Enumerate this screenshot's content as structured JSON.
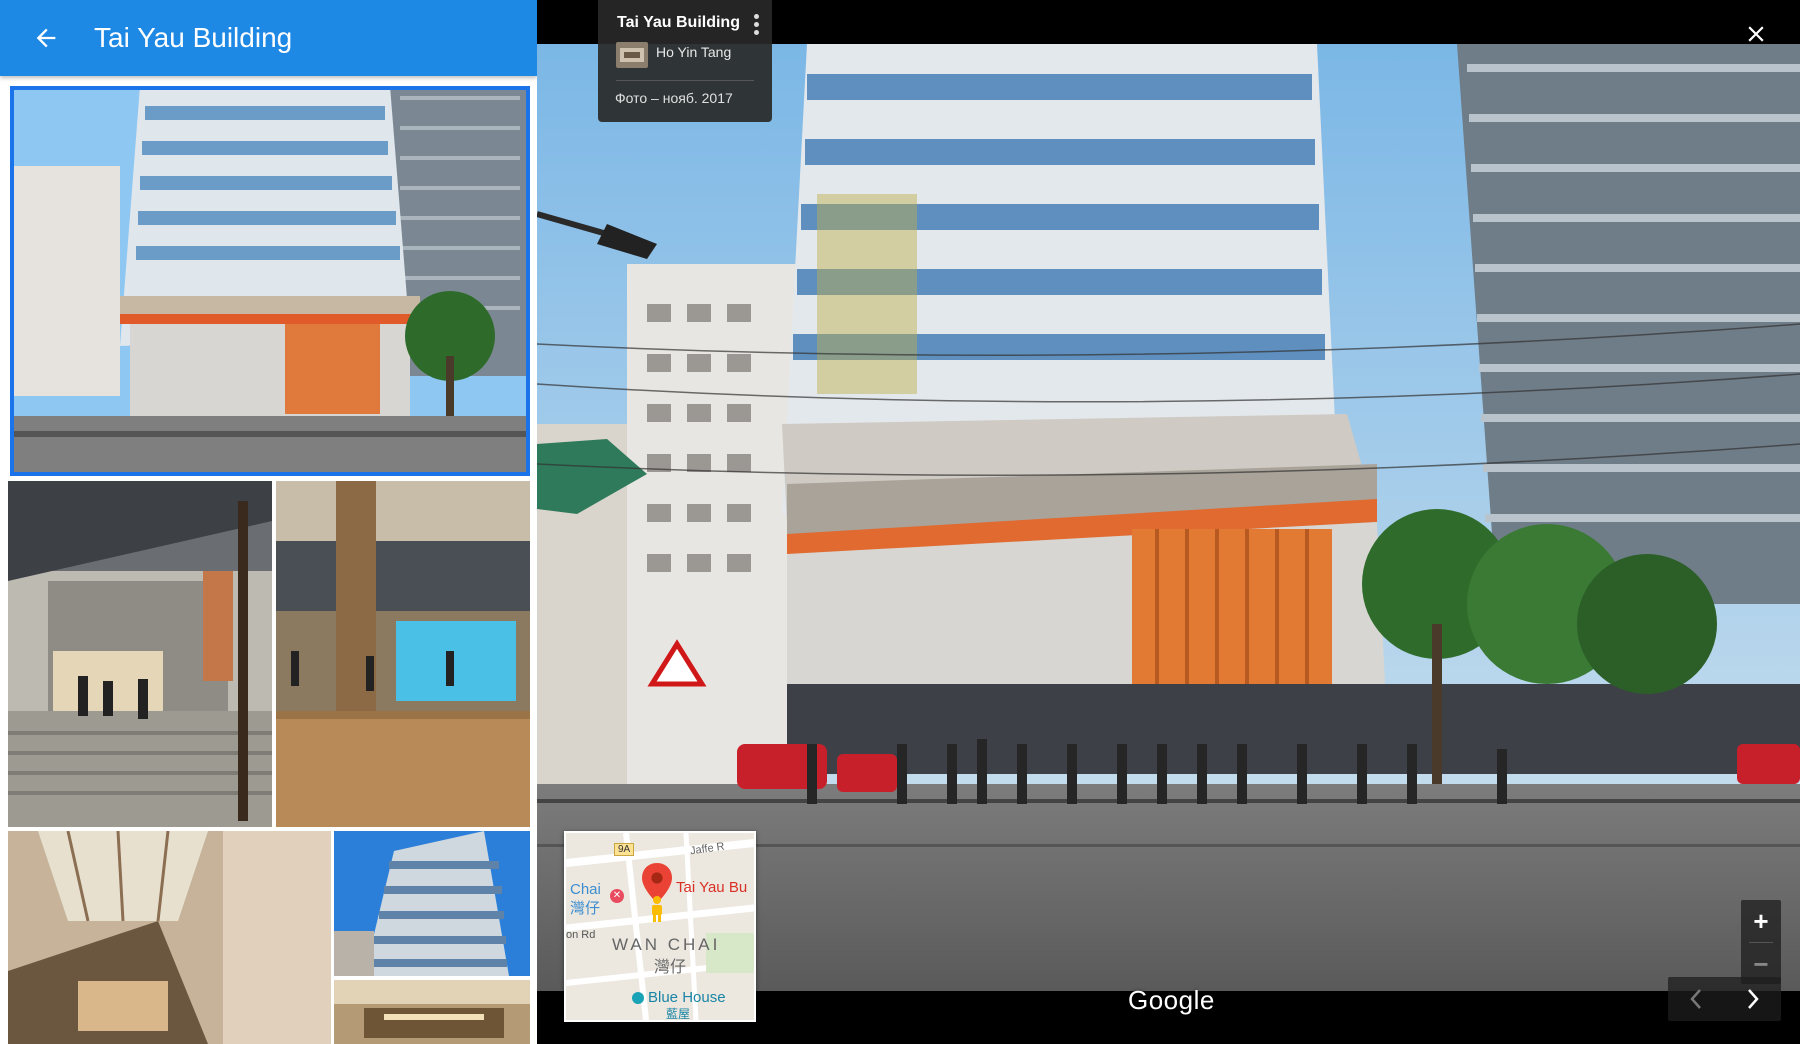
{
  "header": {
    "title": "Tai Yau Building"
  },
  "viewer": {
    "info_title": "Tai Yau Building",
    "author": "Ho Yin Tang",
    "date": "Фото – нояб. 2017",
    "watermark": "Google",
    "zoom_in": "+",
    "zoom_out": "−"
  },
  "minimap": {
    "route_badge": "9A",
    "street_1": "Jaffe R",
    "label_chai": "Chai",
    "label_chai_cn": "灣仔",
    "pin_label": "Tai Yau Bu",
    "street_2": "on Rd",
    "district": "WAN CHAI",
    "district_cn": "灣仔",
    "poi": "Blue House",
    "poi_cn": "藍屋"
  },
  "colors": {
    "header_blue": "#1e88e5",
    "selected_outline": "#1a73e8",
    "pin_red": "#ea4335",
    "pegman": "#fbbc05"
  },
  "icons": [
    "arrow-back-icon",
    "chevron-left-icon",
    "more-vert-icon",
    "close-icon",
    "zoom-in-icon",
    "zoom-out-icon",
    "nav-prev-icon",
    "nav-next-icon",
    "map-pin-icon",
    "pegman-icon"
  ]
}
